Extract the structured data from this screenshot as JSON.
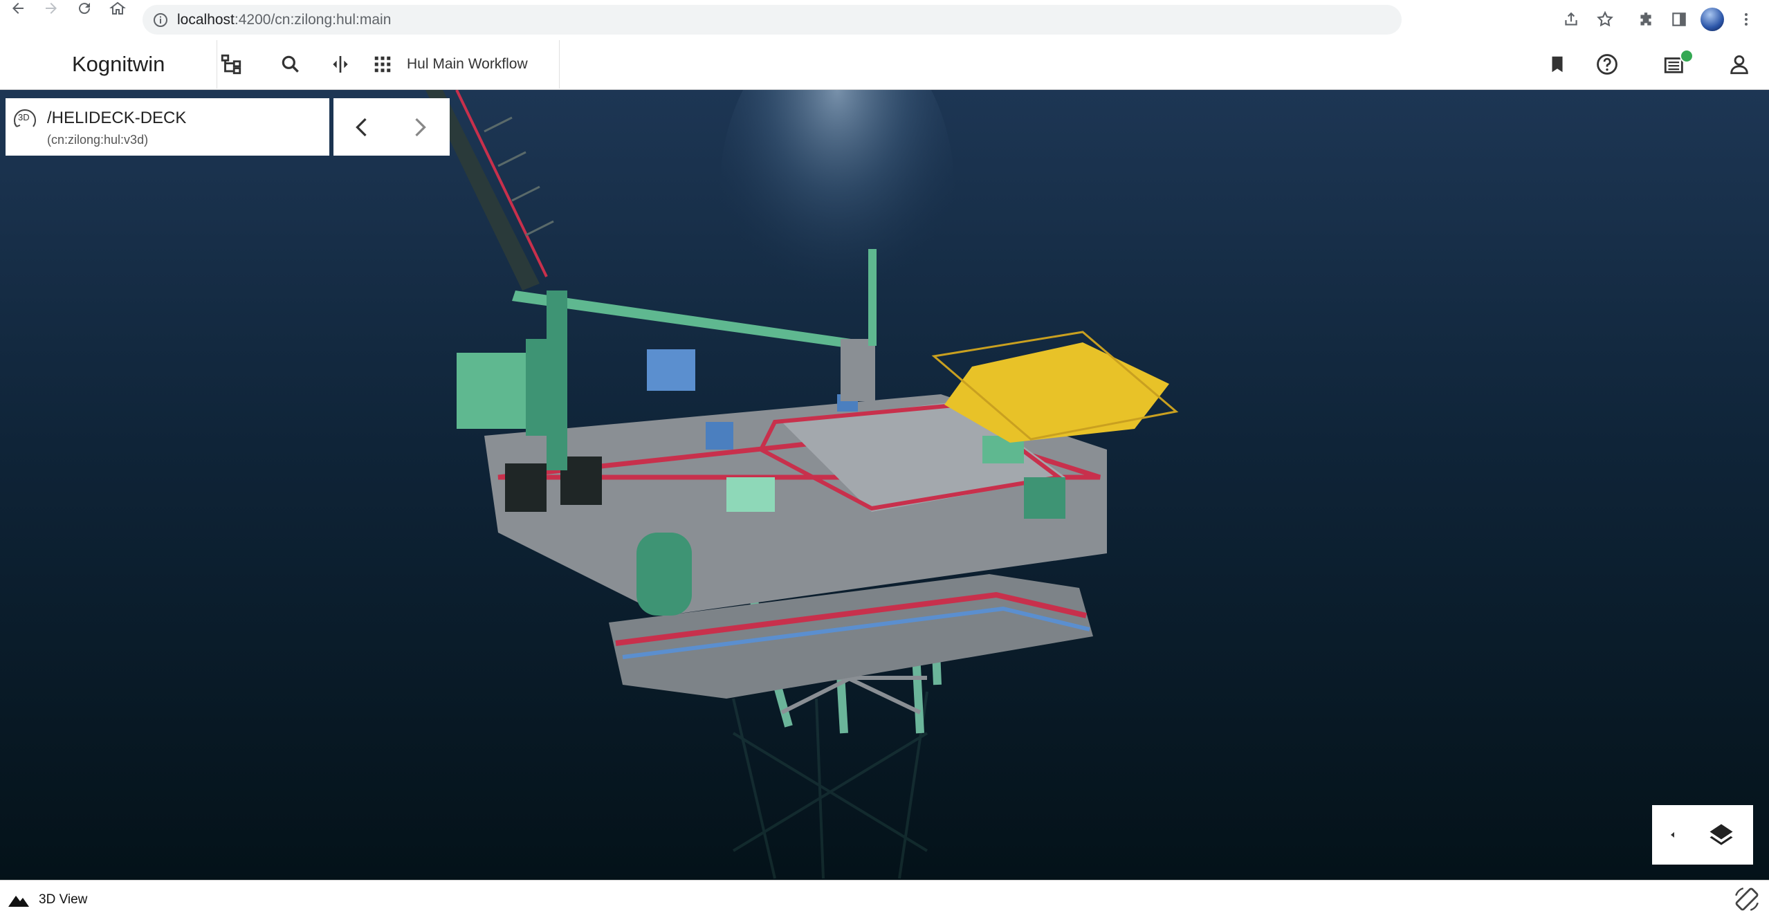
{
  "browser": {
    "url_host": "localhost",
    "url_path": ":4200/cn:zilong:hul:main",
    "icons": [
      "back-icon",
      "forward-icon",
      "reload-icon",
      "home-icon",
      "info-icon",
      "share-icon",
      "star-icon",
      "extensions-icon",
      "sidepanel-icon",
      "profile-avatar",
      "menu-icon"
    ]
  },
  "app": {
    "title": "Kognitwin",
    "workflow": "Hul Main Workflow",
    "header_icons": [
      "tree-hierarchy-icon",
      "search-icon",
      "split-view-icon",
      "apps-grid-icon",
      "bookmark-icon",
      "help-icon",
      "tasks-icon",
      "user-icon"
    ],
    "notification_color": "#34a853"
  },
  "breadcrumb": {
    "badge": "3D",
    "path": "/HELIDECK-DECK",
    "id": "(cn:zilong:hul:v3d)"
  },
  "footer": {
    "view_label": "3D View"
  },
  "colors": {
    "sea_top": "#1b3350",
    "sea_bottom": "#051521",
    "helideck": "#e8c228",
    "structure_green": "#5fb890",
    "structure_grey": "#8a8f94",
    "accent_red": "#c8304c",
    "accent_blue": "#5b8fcf"
  }
}
